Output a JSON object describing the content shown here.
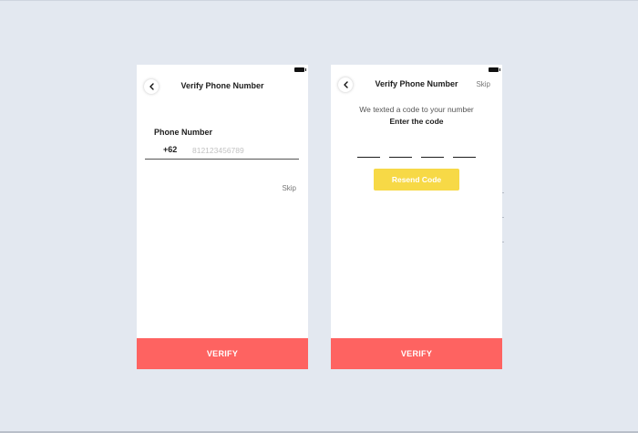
{
  "screen1": {
    "title": "Verify Phone Number",
    "phone_label": "Phone Number",
    "country_code": "+62",
    "phone_placeholder": "812123456789",
    "skip_label": "Skip",
    "verify_label": "VERIFY"
  },
  "screen2": {
    "title": "Verify Phone Number",
    "skip_label": "Skip",
    "instruction": "We texted a code to your number",
    "code_title": "Enter the code",
    "code_digits": [
      "",
      "",
      "",
      ""
    ],
    "resend_label": "Resend Code",
    "verify_label": "VERIFY"
  },
  "colors": {
    "background": "#e3e8f0",
    "verify_button": "#fe6361",
    "resend_button": "#f7d946"
  },
  "icons": {
    "back": "chevron-left-icon",
    "battery": "battery-icon"
  }
}
